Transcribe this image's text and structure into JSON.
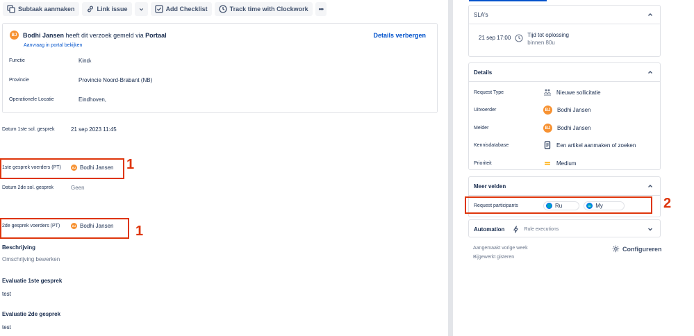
{
  "toolbar": {
    "subtask": "Subtaak aanmaken",
    "link_issue": "Link issue",
    "add_checklist": "Add Checklist",
    "track_time": "Track time with Clockwork",
    "more": "•••"
  },
  "request": {
    "reporter_name": "Bodhi Jansen",
    "reporter_initials": "BJ",
    "action_text": "heeft dit verzoek gemeld via",
    "channel": "Portaal",
    "portal_link": "Aanvraag in portal bekijken",
    "toggle_details": "Details verbergen",
    "fields": [
      {
        "label": "Functie",
        "value": "Kind‹"
      },
      {
        "label": "Provincie",
        "value": "Provincie Noord-Brabant (NB)"
      },
      {
        "label": "Operationele Locatie",
        "value": "Eindhoven,"
      }
    ]
  },
  "fields": {
    "datum1_label": "Datum 1ste sol. gesprek",
    "datum1_value": "21 sep 2023 11:45",
    "voerders1_label": "1ste gesprek voerders (PT)",
    "voerders1_value": "Bodhi Jansen",
    "voerders1_initials": "BJ",
    "datum2_label": "Datum 2de sol. gesprek",
    "datum2_value": "Geen",
    "voerders2_label": "2de gesprek voerders (PT)",
    "voerders2_value": "Bodhi Jansen",
    "voerders2_initials": "BJ"
  },
  "sections": {
    "beschrijving_title": "Beschrijving",
    "beschrijving_text": "Omschrijving bewerken",
    "eval1_title": "Evaluatie 1ste gesprek",
    "eval1_text": "test",
    "eval2_title": "Evaluatie 2de gesprek",
    "eval2_text": "test"
  },
  "annotations": {
    "mark1": "1",
    "mark2": "2",
    "color": "#de350b"
  },
  "sla": {
    "title": "SLA's",
    "date": "21 sep 17:00",
    "goal": "Tijd tot oplossing",
    "remaining": "binnen 80u"
  },
  "details": {
    "title": "Details",
    "rows": [
      {
        "label": "Request Type",
        "value": "Nieuwe sollicitatie"
      },
      {
        "label": "Uitvoerder",
        "value": "Bodhi Jansen"
      },
      {
        "label": "Melder",
        "value": "Bodhi Jansen"
      },
      {
        "label": "Kennisdatabase",
        "value": "Een artikel aanmaken of zoeken"
      },
      {
        "label": "Prioriteit",
        "value": "Medium"
      }
    ],
    "avatar_initials": "BJ",
    "priority_color": "#ffab00"
  },
  "meer_velden": {
    "title": "Meer velden",
    "participants_label": "Request participants",
    "participants": [
      "Ru",
      "My"
    ],
    "participant2_initials": "MJ"
  },
  "automation": {
    "title": "Automation",
    "sub": "Rule executions"
  },
  "footer": {
    "created": "Aangemaakt vorige week",
    "updated": "Bijgewerkt gisteren",
    "configure": "Configureren"
  },
  "colors": {
    "link": "#0052cc",
    "avatar": "#f79232"
  }
}
